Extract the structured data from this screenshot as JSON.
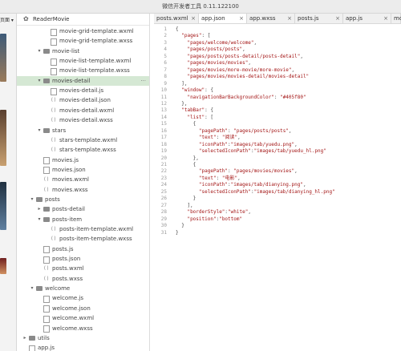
{
  "window": {
    "title": "微信开发者工具 0.11.122100"
  },
  "left_strip": {
    "label": "页面 ▾"
  },
  "explorer": {
    "project": "ReaderMovie",
    "rows": [
      {
        "name": "movie-grid-template.wxml",
        "kind": "file",
        "depth": 3
      },
      {
        "name": "movie-grid-template.wxss",
        "kind": "file",
        "depth": 3
      },
      {
        "name": "movie-list",
        "kind": "folder",
        "depth": 2,
        "open": true
      },
      {
        "name": "movie-list-template.wxml",
        "kind": "file",
        "depth": 3
      },
      {
        "name": "movie-list-template.wxss",
        "kind": "file",
        "depth": 3
      },
      {
        "name": "movies-detail",
        "kind": "folder",
        "depth": 2,
        "open": true,
        "selected": true,
        "more": "···"
      },
      {
        "name": "movies-detail.js",
        "kind": "file",
        "depth": 3
      },
      {
        "name": "movies-detail.json",
        "kind": "brace",
        "depth": 3
      },
      {
        "name": "movies-detail.wxml",
        "kind": "brace",
        "depth": 3
      },
      {
        "name": "movies-detail.wxss",
        "kind": "brace",
        "depth": 3
      },
      {
        "name": "stars",
        "kind": "folder",
        "depth": 2,
        "open": true
      },
      {
        "name": "stars-template.wxml",
        "kind": "brace",
        "depth": 3
      },
      {
        "name": "stars-template.wxss",
        "kind": "brace",
        "depth": 3
      },
      {
        "name": "movies.js",
        "kind": "file",
        "depth": 2
      },
      {
        "name": "movies.json",
        "kind": "file",
        "depth": 2
      },
      {
        "name": "movies.wxml",
        "kind": "brace",
        "depth": 2
      },
      {
        "name": "movies.wxss",
        "kind": "brace",
        "depth": 2
      },
      {
        "name": "posts",
        "kind": "folder",
        "depth": 1,
        "open": true
      },
      {
        "name": "posts-detail",
        "kind": "folder",
        "depth": 2,
        "open": false
      },
      {
        "name": "posts-item",
        "kind": "folder",
        "depth": 2,
        "open": true
      },
      {
        "name": "posts-item-template.wxml",
        "kind": "brace",
        "depth": 3
      },
      {
        "name": "posts-item-template.wxss",
        "kind": "brace",
        "depth": 3
      },
      {
        "name": "posts.js",
        "kind": "file",
        "depth": 2
      },
      {
        "name": "posts.json",
        "kind": "file",
        "depth": 2
      },
      {
        "name": "posts.wxml",
        "kind": "brace",
        "depth": 2
      },
      {
        "name": "posts.wxss",
        "kind": "brace",
        "depth": 2
      },
      {
        "name": "welcome",
        "kind": "folder",
        "depth": 1,
        "open": true
      },
      {
        "name": "welcome.js",
        "kind": "file",
        "depth": 2
      },
      {
        "name": "welcome.json",
        "kind": "file",
        "depth": 2
      },
      {
        "name": "welcome.wxml",
        "kind": "file",
        "depth": 2
      },
      {
        "name": "welcome.wxss",
        "kind": "file",
        "depth": 2
      },
      {
        "name": "utils",
        "kind": "folder",
        "depth": 0,
        "open": false
      },
      {
        "name": "app.js",
        "kind": "file",
        "depth": 0
      }
    ]
  },
  "tabs": [
    {
      "label": "posts.wxml",
      "close": "×",
      "active": false
    },
    {
      "label": "app.json",
      "close": "×",
      "active": true
    },
    {
      "label": "app.wxss",
      "close": "×",
      "active": false
    },
    {
      "label": "posts.js",
      "close": "×",
      "active": false
    },
    {
      "label": "app.js",
      "close": "×",
      "active": false
    },
    {
      "label": "movie",
      "close": "",
      "active": false
    }
  ],
  "code": [
    "{",
    "  \"pages\": [",
    "    \"pages/welcome/welcome\",",
    "    \"pages/posts/posts\",",
    "    \"pages/posts/posts-detail/posts-detail\",",
    "    \"pages/movies/movies\",",
    "    \"pages/movies/more-movie/more-movie\",",
    "    \"pages/movies/movies-detail/movies-detail\"",
    "  ],",
    "  \"window\": {",
    "    \"navigationBarBackgroundColor\": \"#405f80\"",
    "  },",
    "  \"tabBar\": {",
    "    \"list\": [",
    "      {",
    "        \"pagePath\": \"pages/posts/posts\",",
    "        \"text\": \"阅读\",",
    "        \"iconPath\":\"images/tab/yuedu.png\",",
    "        \"selectedIconPath\":\"images/tab/yuedu_hl.png\"",
    "      },",
    "      {",
    "        \"pagePath\": \"pages/movies/movies\",",
    "        \"text\": \"电影\",",
    "        \"iconPath\":\"images/tab/dianying.png\",",
    "        \"selectedIconPath\":\"images/tab/dianying_hl.png\"",
    "      }",
    "    ],",
    "    \"borderStyle\":\"white\",",
    "    \"position\":\"bottom\"",
    "  }",
    "}"
  ],
  "colors": {
    "selected_row": "#d5e8d4",
    "string": "#a31515"
  }
}
